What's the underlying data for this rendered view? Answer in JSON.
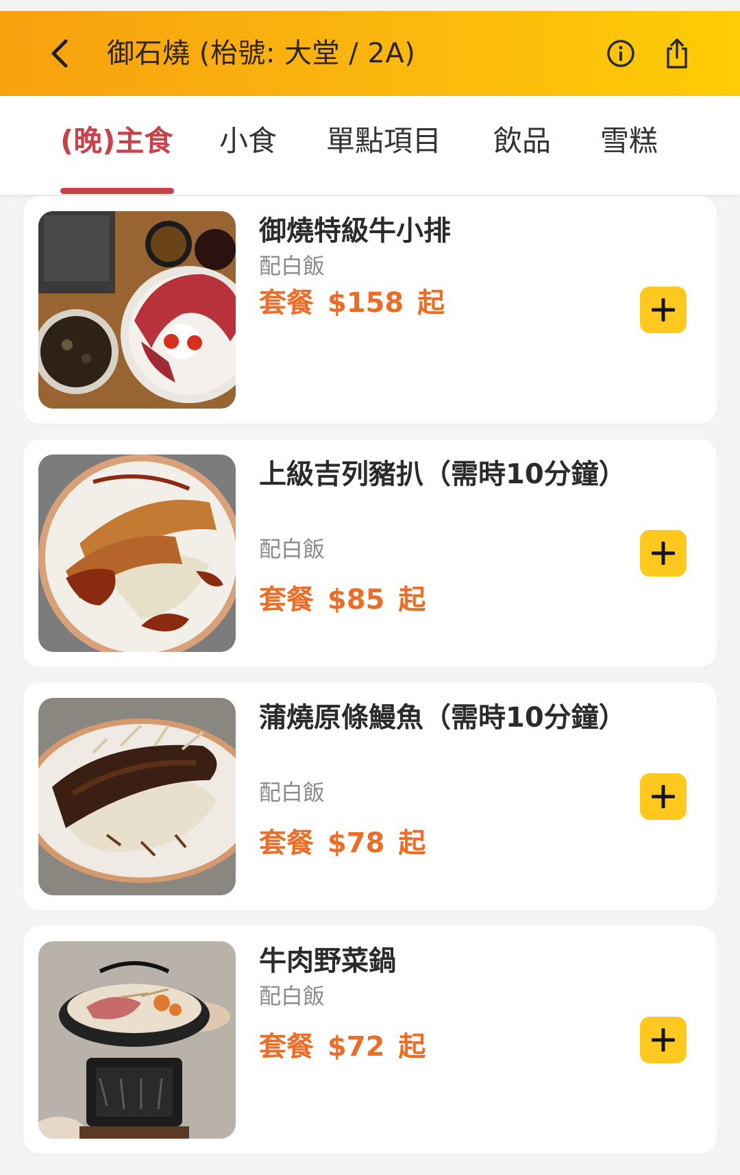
{
  "header": {
    "title": "御石燒 (枱號: 大堂 / 2A)",
    "back_icon": "chevron-left-icon",
    "info_icon": "info-icon",
    "share_icon": "share-icon",
    "gradient_colors": [
      "#f7a10f",
      "#ffcc05"
    ]
  },
  "tabs": [
    {
      "label": "(晚)主食",
      "active": true
    },
    {
      "label": "小食",
      "active": false
    },
    {
      "label": "單點項目",
      "active": false
    },
    {
      "label": "飲品",
      "active": false
    },
    {
      "label": "雪糕",
      "active": false
    }
  ],
  "colors": {
    "accent_tab": "#c8424a",
    "price": "#ee6d26",
    "add_button": "#ffc81e"
  },
  "items": [
    {
      "name": "御燒特級牛小排",
      "sub": "配白飯",
      "price": "套餐 $158 起",
      "image": "beef-short-rib-set-photo",
      "add_icon": "plus-icon"
    },
    {
      "name": "上級吉列豬扒（需時10分鐘）",
      "sub": "配白飯",
      "price": "套餐 $85 起",
      "image": "pork-cutlet-photo",
      "add_icon": "plus-icon"
    },
    {
      "name": "蒲燒原條鰻魚（需時10分鐘）",
      "sub": "配白飯",
      "price": "套餐 $78 起",
      "image": "grilled-eel-photo",
      "add_icon": "plus-icon"
    },
    {
      "name": "牛肉野菜鍋",
      "sub": "配白飯",
      "price": "套餐 $72 起",
      "image": "beef-vegetable-hotpot-photo",
      "add_icon": "plus-icon"
    }
  ]
}
